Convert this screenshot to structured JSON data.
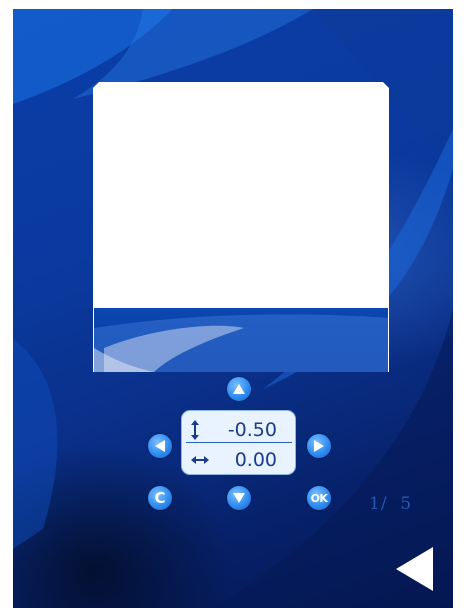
{
  "screen": {
    "background_color": "#0a3aa0",
    "accent_color": "#2f8cf0"
  },
  "preview": {
    "image_color": "#ffffff"
  },
  "controls": {
    "up_icon": "arrow-up-icon",
    "down_icon": "arrow-down-icon",
    "left_icon": "arrow-left-icon",
    "right_icon": "arrow-right-icon",
    "clear_label": "C",
    "ok_label": "OK"
  },
  "offset": {
    "vertical_icon": "vertical-arrows-icon",
    "vertical_value": "-0.50",
    "horizontal_icon": "horizontal-arrows-icon",
    "horizontal_value": "0.00"
  },
  "page": {
    "counter": "1/  5"
  },
  "navigation": {
    "back_icon": "back-triangle-icon"
  }
}
